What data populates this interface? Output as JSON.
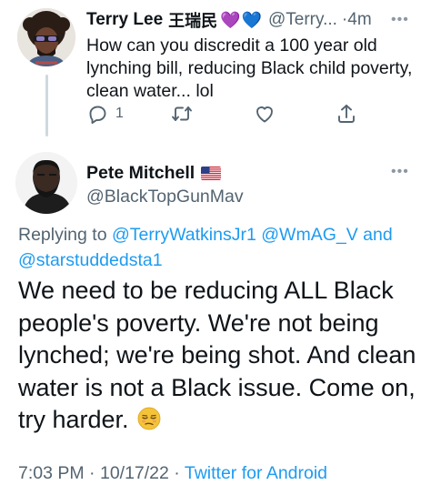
{
  "reply_tweet": {
    "author_name": "Terry Lee",
    "author_name_cjk": "王瑞民",
    "emoji_hearts": [
      "💜",
      "💙"
    ],
    "handle": "@Terry...",
    "separator": "·",
    "time": "4m",
    "more_label": "•••",
    "text": "How can you discredit a 100 year old lynching bill, reducing Black child poverty, clean water... lol",
    "actions": {
      "reply_icon": "reply-icon",
      "reply_count": "1",
      "retweet_icon": "retweet-icon",
      "like_icon": "heart-icon",
      "share_icon": "share-icon"
    }
  },
  "main_tweet": {
    "author_name": "Pete Mitchell",
    "flag": "🇺🇸",
    "handle": "@BlackTopGunMav",
    "more_label": "•••",
    "replying_prefix": "Replying to",
    "mentions": [
      "@TerryWatkinsJr1",
      "@WmAG_V",
      "@starstuddedsta1"
    ],
    "replying_and": "and",
    "text": "We need to be reducing ALL Black people's poverty. We're not being lynched; we're being shot. And clean water is not a Black issue. Come on, try harder.",
    "emoji": "😒",
    "time": "7:03 PM",
    "dot": "·",
    "date": "10/17/22",
    "source": "Twitter for Android"
  },
  "colors": {
    "text": "#0f1419",
    "secondary": "#536471",
    "link": "#1d9bf0",
    "thread_line": "#cfd9de"
  }
}
